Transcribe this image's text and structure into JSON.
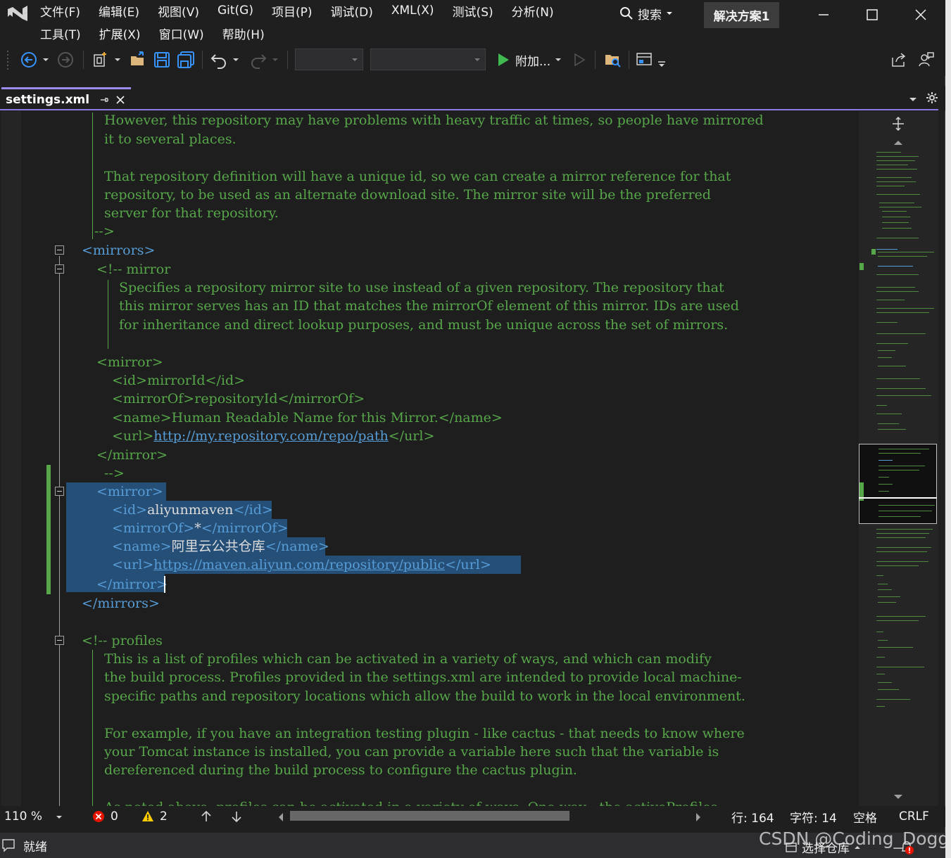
{
  "menubar": {
    "row1": [
      "文件(F)",
      "编辑(E)",
      "视图(V)",
      "Git(G)",
      "项目(P)",
      "调试(D)",
      "XML(X)",
      "测试(S)",
      "分析(N)"
    ],
    "row2": [
      "工具(T)",
      "扩展(X)",
      "窗口(W)",
      "帮助(H)"
    ],
    "search_label": "搜索",
    "solution_name": "解决方案1"
  },
  "toolbar": {
    "attach_label": "附加..."
  },
  "tab": {
    "filename": "settings.xml"
  },
  "code_lines": {
    "l1": "However, this repository may have problems with heavy traffic at times, so people have mirrored",
    "l2": "it to several places.",
    "l3": "That repository definition will have a unique id, so we can create a mirror reference for that",
    "l4": "repository, to be used as an alternate download site. The mirror site will be the preferred",
    "l5": "server for that repository.",
    "l6": "-->",
    "mirrors_open": "<mirrors>",
    "mirror_comment_open": "<!-- mirror",
    "l9": "Specifies a repository mirror site to use instead of a given repository. The repository that",
    "l10": "this mirror serves has an ID that matches the mirrorOf element of this mirror. IDs are used",
    "l11": "for inheritance and direct lookup purposes, and must be unique across the set of mirrors.",
    "mirror_open": "<mirror>",
    "id_line": {
      "open": "<id>",
      "value": "mirrorId",
      "close": "</id>"
    },
    "mirrorof_line": {
      "open": "<mirrorOf>",
      "value": "repositoryId",
      "close": "</mirrorOf>"
    },
    "name_line": {
      "open": "<name>",
      "value": "Human Readable Name for this Mirror.",
      "close": "</name>"
    },
    "url_line": {
      "open": "<url>",
      "value": "http://my.repository.com/repo/path",
      "close": "</url>"
    },
    "mirror_close": "</mirror>",
    "comment_close": "-->",
    "sel_mirror_open": "<mirror>",
    "sel_id": {
      "open": "<id>",
      "value": "aliyunmaven",
      "close": "</id>"
    },
    "sel_mirrorof": {
      "open": "<mirrorOf>",
      "value": "*",
      "close": "</mirrorOf>"
    },
    "sel_name": {
      "open": "<name>",
      "value": "阿里云公共仓库",
      "close": "</name>"
    },
    "sel_url": {
      "open": "<url>",
      "value": "https://maven.aliyun.com/repository/public",
      "close": "</url>"
    },
    "sel_mirror_close": "</mirror>",
    "mirrors_close": "</mirrors>",
    "profiles_comment_open": "<!-- profiles",
    "p1": "This is a list of profiles which can be activated in a variety of ways, and which can modify",
    "p2": "the build process. Profiles provided in the settings.xml are intended to provide local machine-",
    "p3": "specific paths and repository locations which allow the build to work in the local environment.",
    "p4": "For example, if you have an integration testing plugin - like cactus - that needs to know where",
    "p5": "your Tomcat instance is installed, you can provide a variable here such that the variable is",
    "p6": "dereferenced during the build process to configure the cactus plugin.",
    "p7": "As noted above, profiles can be activated in a variety of ways. One way - the activeProfiles"
  },
  "editor_status": {
    "zoom": "110 %",
    "errors": "0",
    "warnings": "2",
    "line": "行: 164",
    "char": "字符: 14",
    "whitespace": "空格",
    "line_ending": "CRLF"
  },
  "statusbar": {
    "ready": "就绪",
    "repo": "选择仓库"
  },
  "watermark": "CSDN @Coding_Doggy",
  "colors": {
    "comment": "#57a64a",
    "tag": "#569cd6",
    "selection": "#264f78",
    "tab_accent": "#9b8cf0"
  }
}
